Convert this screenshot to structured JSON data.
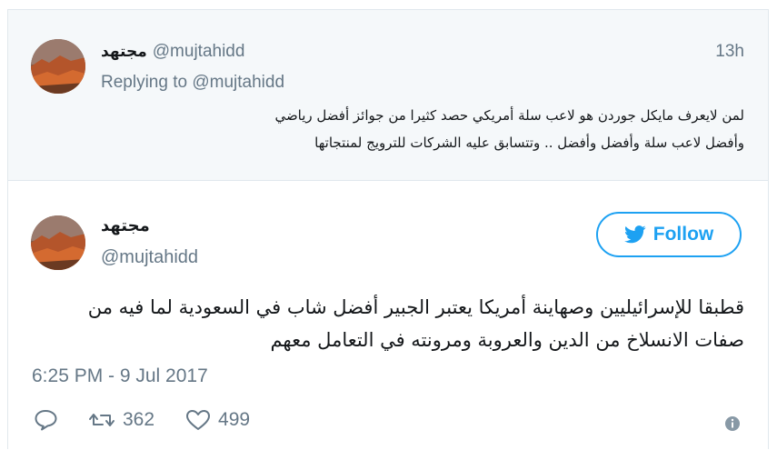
{
  "reply_tweet": {
    "display_name": "مجتهد",
    "handle": "@mujtahidd",
    "time_ago": "13h",
    "replying_prefix": "Replying to",
    "replying_mention": "@mujtahidd",
    "text_line1": "لمن لايعرف مايكل جوردن هو لاعب سلة أمريكي حصد كثيرا من جوائز أفضل رياضي",
    "text_line2": "وأفضل لاعب سلة وأفضل وأفضل .. وتتسابق عليه الشركات للترويج لمنتجاتها"
  },
  "main_tweet": {
    "display_name": "مجتهد",
    "handle": "@mujtahidd",
    "follow_label": "Follow",
    "text_line1": "قطبقا للإسرائيليين وصهاينة أمريكا يعتبر الجبير أفضل شاب في السعودية لما فيه من",
    "text_line2": "صفات الانسلاخ من الدين والعروبة ومرونته في التعامل معهم",
    "datetime": "6:25 PM - 9 Jul 2017",
    "retweet_count": "362",
    "like_count": "499"
  },
  "icons": {
    "reply": "reply-bubble-icon",
    "retweet": "retweet-icon",
    "like": "heart-icon",
    "follow": "twitter-bird-icon",
    "info": "info-icon"
  },
  "colors": {
    "accent": "#1da1f2",
    "muted": "#657786",
    "reply_bg": "#f5f8fa"
  }
}
